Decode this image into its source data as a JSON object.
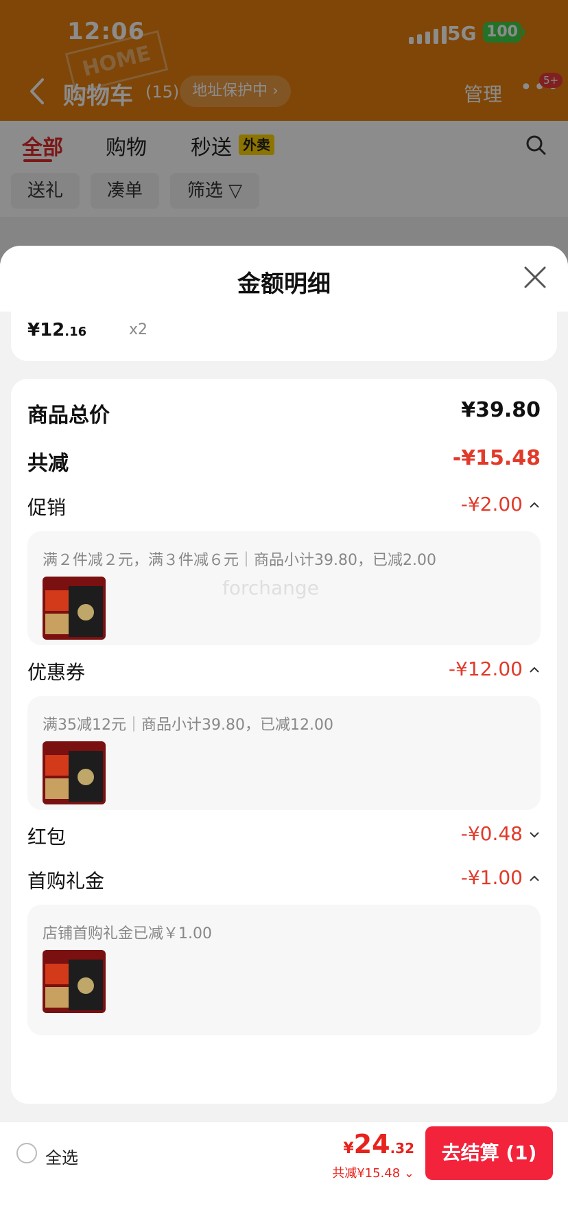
{
  "status_bar": {
    "time": "12:06",
    "network": "5G",
    "battery": "100"
  },
  "nav": {
    "title": "购物车",
    "count": "(15)",
    "address_protect": "地址保护中",
    "manage": "管理",
    "more_badge": "5+"
  },
  "tabs": [
    "全部",
    "购物",
    "秒送"
  ],
  "takeout_tag": "外卖",
  "chips": [
    "送礼",
    "凑单",
    "筛选"
  ],
  "sheet": {
    "title": "金额明细",
    "item": {
      "price_int": "¥12",
      "price_dec": ".16",
      "qty": "x2"
    },
    "total_label": "商品总价",
    "total_value": "¥39.80",
    "discount_label": "共减",
    "discount_value": "-¥15.48",
    "promo_label": "促销",
    "promo_value": "-¥2.00",
    "promo_detail": "满２件减２元，满３件减６元｜商品小计39.80，已减2.00",
    "coupon_label": "优惠券",
    "coupon_value": "-¥12.00",
    "coupon_detail": "满35减12元｜商品小计39.80，已减12.00",
    "redpacket_label": "红包",
    "redpacket_value": "-¥0.48",
    "firstbuy_label": "首购礼金",
    "firstbuy_value": "-¥1.00",
    "firstbuy_detail": "店铺首购礼金已减￥1.00"
  },
  "footer": {
    "select_all": "全选",
    "total_sym": "¥",
    "total_int": "24",
    "total_dec": ".32",
    "saved": "共减¥15.48",
    "checkout": "去结算 (1)"
  },
  "watermark": "forchange",
  "colors": {
    "accent": "#e23a2a",
    "header": "#e8800d",
    "checkout": "#f2233b"
  }
}
